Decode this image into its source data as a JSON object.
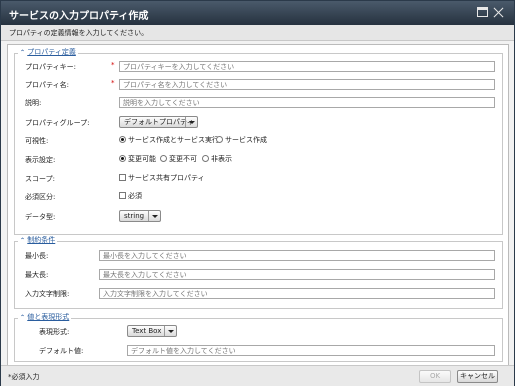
{
  "window": {
    "title": "サービスの入力プロパティ作成",
    "subtitle": "プロパティの定義情報を入力してください。"
  },
  "property_definition": {
    "header": "プロパティ定義",
    "key_label": "プロパティキー:",
    "key_placeholder": "プロパティキーを入力してください",
    "name_label": "プロパティ名:",
    "name_placeholder": "プロパティ名を入力してください",
    "desc_label": "説明:",
    "desc_placeholder": "説明を入力してください",
    "group_label": "プロパティグループ:",
    "group_value": "デフォルトプロパティ",
    "visibility_label": "可視性:",
    "visibility_options": [
      "サービス作成とサービス実行",
      "サービス作成"
    ],
    "display_label": "表示設定:",
    "display_options": [
      "変更可能",
      "変更不可",
      "非表示"
    ],
    "scope_label": "スコープ:",
    "scope_option": "サービス共有プロパティ",
    "required_label": "必須区分:",
    "required_option": "必須",
    "datatype_label": "データ型:",
    "datatype_value": "string",
    "required_mark": "*"
  },
  "constraints": {
    "header": "制約条件",
    "min_label": "最小長:",
    "min_placeholder": "最小長を入力してください",
    "max_label": "最大長:",
    "max_placeholder": "最大長を入力してください",
    "charlimit_label": "入力文字制限:",
    "charlimit_placeholder": "入力文字制限を入力してください"
  },
  "value_format": {
    "header": "値と表現形式",
    "format_label": "表現形式:",
    "format_value": "Text Box",
    "default_label": "デフォルト値:",
    "default_placeholder": "デフォルト値を入力してください"
  },
  "footer": {
    "note": "*必須入力",
    "ok": "OK",
    "cancel": "キャンセル"
  }
}
